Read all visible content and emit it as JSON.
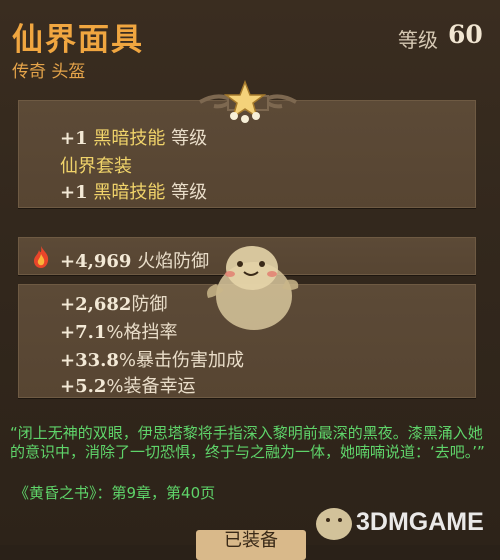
{
  "item": {
    "name": "仙界面具",
    "subtitle": "传奇 头盔",
    "level_label": "等级",
    "level_value": "60"
  },
  "set_panel": {
    "line1_prefix": "+1",
    "line1_skill": "黑暗技能",
    "line1_suffix": "等级",
    "set_name": "仙界套装",
    "line2_prefix": "+1",
    "line2_skill": "黑暗技能",
    "line2_suffix": "等级"
  },
  "primary_stat": {
    "icon": "fire-icon",
    "value": "+4,969",
    "label": "火焰防御"
  },
  "stats": [
    {
      "value": "+2,682",
      "label": "防御"
    },
    {
      "value": "+7.1",
      "label": "%格挡率"
    },
    {
      "value": "+33.8",
      "label": "%暴击伤害加成"
    },
    {
      "value": "+5.2",
      "label": "%装备幸运"
    }
  ],
  "lore": "“闭上无神的双眼，伊思塔黎将手指深入黎明前最深的黑夜。漆黑涌入她的意识中，消除了一切恐惧，终于与之融为一体，她喃喃说道：‘去吧。’”",
  "citation": "《黄昏之书》：第9章，第40页",
  "bottom_button": "已装备",
  "watermark": "3DMGAME",
  "colors": {
    "name": "#f0a640",
    "highlight": "#f0d36a",
    "lore": "#5fd46a",
    "panel": "#5c4a37",
    "background": "#33281d"
  }
}
